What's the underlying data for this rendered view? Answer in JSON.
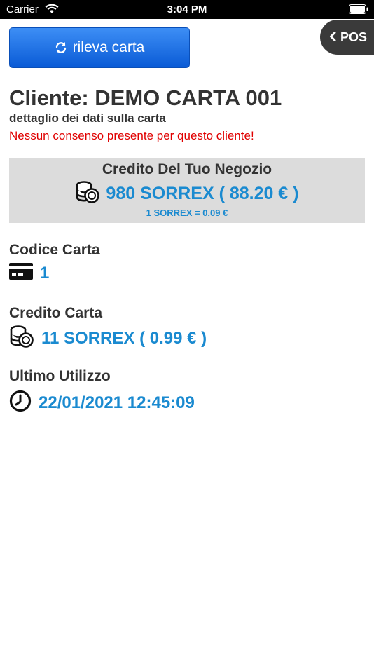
{
  "status_bar": {
    "carrier": "Carrier",
    "time": "3:04 PM"
  },
  "header": {
    "detect_button_label": "rileva carta",
    "pos_button_label": "POS"
  },
  "client": {
    "title": "Cliente: DEMO CARTA 001",
    "subtitle": "dettaglio dei dati sulla carta",
    "consent_warning": "Nessun consenso presente per questo cliente!"
  },
  "store_credit": {
    "title": "Credito Del Tuo Negozio",
    "value": "980 SORREX ( 88.20 € )",
    "rate": "1 SORREX = 0.09 €"
  },
  "card_code": {
    "label": "Codice Carta",
    "value": "1"
  },
  "card_credit": {
    "label": "Credito Carta",
    "value": "11 SORREX ( 0.99 € )"
  },
  "last_use": {
    "label": "Ultimo Utilizzo",
    "value": "22/01/2021 12:45:09"
  },
  "icons": {
    "refresh": "refresh-icon",
    "back": "chevron-left-icon",
    "coins": "coins-icon",
    "card": "credit-card-icon",
    "clock": "clock-icon"
  },
  "colors": {
    "accent_blue": "#1a8ad0",
    "button_blue": "#0a5bd6",
    "warning_red": "#e00000",
    "pos_dark": "#3a3a3a",
    "box_gray": "#dcdcdc"
  }
}
